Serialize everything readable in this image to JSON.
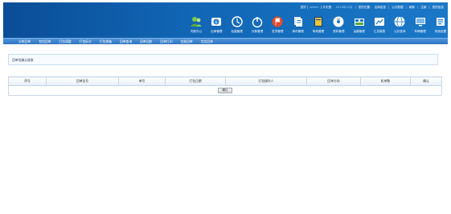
{
  "top_links": [
    {
      "text": "您好 [",
      "highlight": false
    },
    {
      "text": "admin",
      "highlight": true
    },
    {
      "text": "] 今天是：",
      "highlight": false
    },
    {
      "text": "2013年12月",
      "highlight": true
    },
    {
      "text": "您的位置：",
      "highlight": false
    },
    {
      "text": "出库信息",
      "highlight": false
    },
    {
      "text": "公共数据",
      "highlight": false
    },
    {
      "text": "刷新",
      "highlight": false
    },
    {
      "text": "注销",
      "highlight": false
    },
    {
      "text": "您的信息",
      "highlight": false
    }
  ],
  "toolbar_icons": [
    {
      "label": "内部办公",
      "icon": "people-icon",
      "color": "#7ec850"
    },
    {
      "label": "出库管理",
      "icon": "dollar-icon",
      "color": "#ffffff"
    },
    {
      "label": "包装管理",
      "icon": "clock-icon",
      "color": "#ffffff"
    },
    {
      "label": "分拣管理",
      "icon": "power-icon",
      "color": "#ffffff"
    },
    {
      "label": "发货管理",
      "icon": "flag-icon",
      "color": "#e34a2c"
    },
    {
      "label": "库存管理",
      "icon": "files-icon",
      "color": "#ffffff"
    },
    {
      "label": "场地管理",
      "icon": "book-icon",
      "color": "#e8c53a"
    },
    {
      "label": "资料管理",
      "icon": "disc-icon",
      "color": "#ffffff"
    },
    {
      "label": "运营管理",
      "icon": "grid-icon",
      "color": "#ffffff"
    },
    {
      "label": "汇总报表",
      "icon": "chart-icon",
      "color": "#ffffff"
    },
    {
      "label": "公共查询",
      "icon": "globe-icon",
      "color": "#ffffff"
    },
    {
      "label": "车辆管理",
      "icon": "screen-icon",
      "color": "#ffffff"
    },
    {
      "label": "系统设置",
      "icon": "settings-icon",
      "color": "#ffffff"
    }
  ],
  "nav_items": [
    "分拣回单",
    "包包回单",
    "打包调整",
    "打包拆分",
    "打包装箱",
    "回单查询",
    "回单回收",
    "回单打印",
    "包装回单",
    "包包回单"
  ],
  "panel": {
    "title": "回单包确认接收"
  },
  "table": {
    "columns": [
      "序号",
      "回单包号",
      "单号",
      "打包日期",
      "打包操作人",
      "回单方向",
      "机单数",
      "确认"
    ],
    "confirm_label": "确认"
  },
  "colors": {
    "header_dark": "#0a4d96",
    "header_light": "#1a78c8",
    "nav": "#2f75c2",
    "border": "#c5d6e8"
  }
}
